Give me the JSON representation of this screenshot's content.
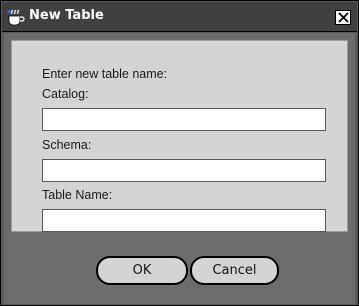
{
  "window": {
    "title": "New Table",
    "icon": "java-coffee-icon",
    "close_icon": "close-x-icon"
  },
  "form": {
    "prompt": "Enter new table name:",
    "fields": [
      {
        "label": "Catalog:",
        "value": ""
      },
      {
        "label": "Schema:",
        "value": ""
      },
      {
        "label": "Table Name:",
        "value": ""
      }
    ]
  },
  "buttons": {
    "ok_label": "OK",
    "cancel_label": "Cancel"
  },
  "colors": {
    "titlebar": "#404040",
    "client": "#6c6c6c",
    "panel": "#d4d4d4"
  }
}
